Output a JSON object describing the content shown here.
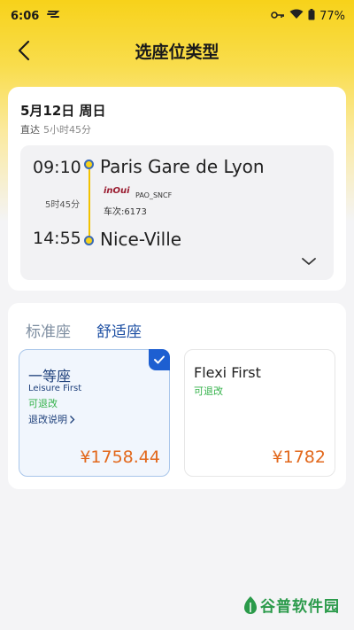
{
  "status_bar": {
    "time": "6:06",
    "battery": "77%"
  },
  "nav": {
    "title": "选座位类型"
  },
  "trip": {
    "date": "5月12日 周日",
    "direct_label": "直达",
    "duration_label": "5小时45分",
    "departure_time": "09:10",
    "departure_station": "Paris Gare de Lyon",
    "arrival_time": "14:55",
    "arrival_station": "Nice-Ville",
    "total_duration": "5时45分",
    "brand_logo": "inOui",
    "operator": "PAO_SNCF",
    "train_number": "车次:6173"
  },
  "seat_tabs": {
    "standard": "标准座",
    "comfort": "舒适座"
  },
  "options": [
    {
      "title": "一等座",
      "subtitle": "Leisure First",
      "change": "可退改",
      "rules": "退改说明",
      "price": "¥1758.44"
    },
    {
      "title": "Flexi First",
      "change": "可退改",
      "price": "¥1782"
    }
  ],
  "watermark": {
    "text": "谷普软件园"
  },
  "colors": {
    "accent_yellow": "#f7d21a",
    "brand_blue": "#1d5fd1",
    "price_orange": "#e2681c",
    "green": "#34b24a"
  }
}
